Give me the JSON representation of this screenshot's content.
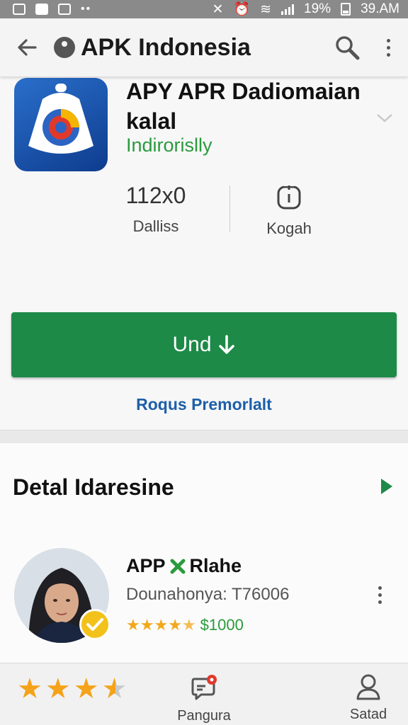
{
  "status_bar": {
    "battery": "19%",
    "time": "39.AM"
  },
  "app_bar": {
    "title": "APK Indonesia"
  },
  "app": {
    "name_line1": "APY APR Dadiomaian",
    "name_line2": "kalal",
    "developer": "Indirorislly",
    "stats": {
      "downloads_value": "112x0",
      "downloads_label": "Dalliss",
      "info_label": "Kogah"
    },
    "install_label": "Und",
    "promo_link": "Roqus Premorlalt"
  },
  "details": {
    "section_title": "Detal Idaresine",
    "item": {
      "title": "APP",
      "title_suffix": "Rlahe",
      "subtitle": "Dounahonya: T76006",
      "rating": 4.5,
      "price": "$1000"
    }
  },
  "bottom_nav": {
    "rating": 3.5,
    "items": [
      {
        "label": "Pangura",
        "icon": "message-icon"
      },
      {
        "label": "Satad",
        "icon": "user-icon"
      }
    ]
  },
  "colors": {
    "accent_green": "#1e8a48",
    "developer_green": "#2a9a3c",
    "link_blue": "#1d5fa8",
    "star_orange": "#f4a31a"
  }
}
